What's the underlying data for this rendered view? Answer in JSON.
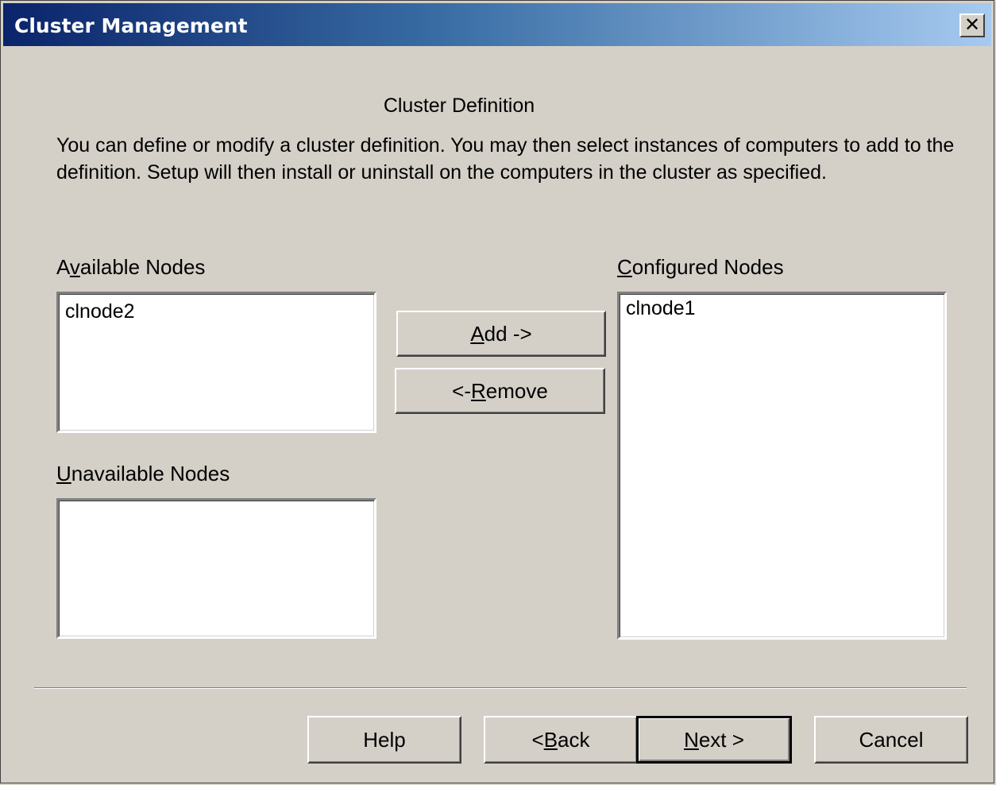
{
  "window": {
    "title": "Cluster Management",
    "close_glyph": "✕"
  },
  "content": {
    "heading": "Cluster Definition",
    "description": "You can define or modify a cluster definition.  You may then select instances of computers to add to the definition.  Setup will then install or uninstall on the computers in the cluster as specified."
  },
  "available": {
    "label_pre": "A",
    "label_access": "v",
    "label_post": "ailable Nodes",
    "items": [
      "clnode2"
    ]
  },
  "unavailable": {
    "label_access": "U",
    "label_post": "navailable Nodes",
    "items": []
  },
  "configured": {
    "label_access": "C",
    "label_post": "onfigured Nodes",
    "items": [
      "clnode1"
    ]
  },
  "buttons": {
    "add_access": "A",
    "add_post": "dd ->",
    "remove_pre": "<- ",
    "remove_access": "R",
    "remove_post": "emove",
    "help": "Help",
    "back_pre": "< ",
    "back_access": "B",
    "back_post": "ack",
    "next_access": "N",
    "next_post": "ext >",
    "cancel": "Cancel"
  }
}
